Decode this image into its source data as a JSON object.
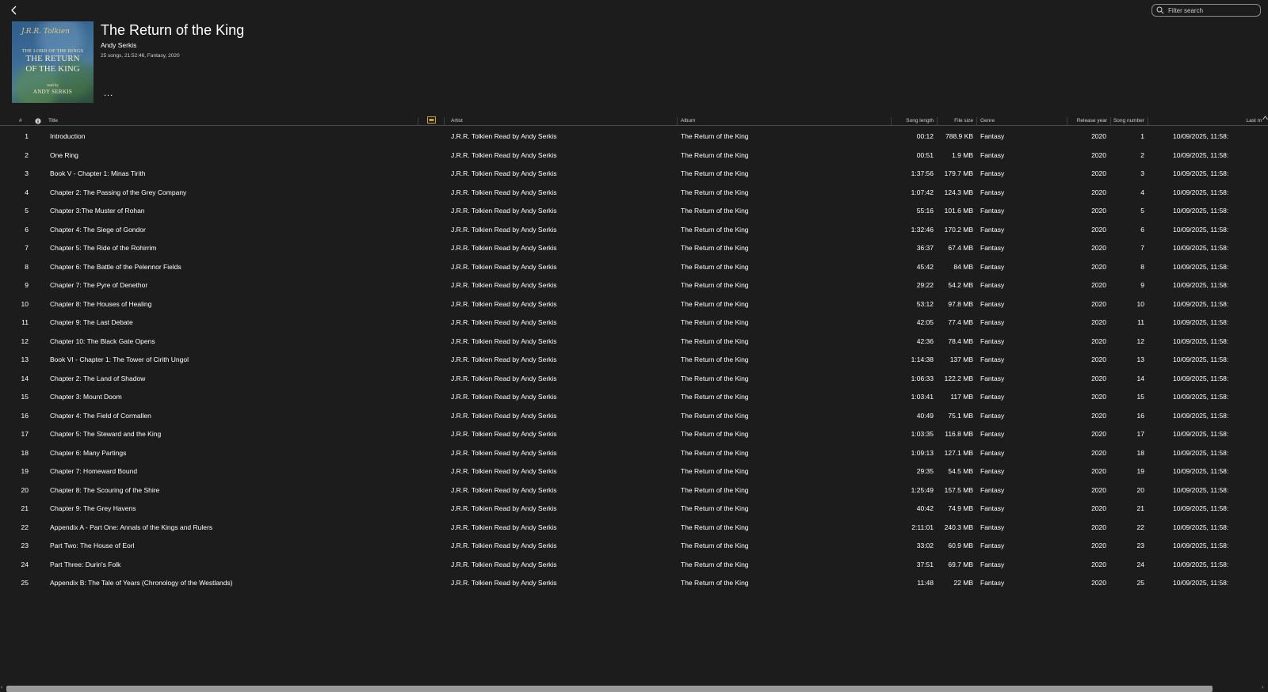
{
  "search": {
    "placeholder": "Filter search"
  },
  "album": {
    "title": "The Return of the King",
    "artist": "Andy Serkis",
    "meta": "25 songs, 21:52:46, Fantasy, 2020",
    "more": "...",
    "cover": {
      "signature": "J.R.R. Tolkien",
      "line1": "THE LORD OF THE RINGS",
      "line2": "THE RETURN",
      "line3": "OF THE KING",
      "line4": "read by",
      "line5": "ANDY SERKIS"
    }
  },
  "columns": {
    "num": "#",
    "title": "Title",
    "artist": "Artist",
    "album": "Album",
    "length": "Song length",
    "size": "File size",
    "genre": "Genre",
    "year": "Release year",
    "songnum": "Song number",
    "last": "Last m"
  },
  "rows": [
    {
      "num": "1",
      "title": "Introduction",
      "artist": "J.R.R. Tolkien Read by Andy Serkis",
      "album": "The Return of the King",
      "length": "00:12",
      "size": "788.9 KB",
      "genre": "Fantasy",
      "year": "2020",
      "songnum": "1",
      "last": "10/09/2025, 11:58:"
    },
    {
      "num": "2",
      "title": "One Ring",
      "artist": "J.R.R. Tolkien Read by Andy Serkis",
      "album": "The Return of the King",
      "length": "00:51",
      "size": "1.9 MB",
      "genre": "Fantasy",
      "year": "2020",
      "songnum": "2",
      "last": "10/09/2025, 11:58:"
    },
    {
      "num": "3",
      "title": "Book V - Chapter 1: Minas Tirith",
      "artist": "J.R.R. Tolkien Read by Andy Serkis",
      "album": "The Return of the King",
      "length": "1:37:56",
      "size": "179.7 MB",
      "genre": "Fantasy",
      "year": "2020",
      "songnum": "3",
      "last": "10/09/2025, 11:58:"
    },
    {
      "num": "4",
      "title": "Chapter 2: The Passing of the Grey Company",
      "artist": "J.R.R. Tolkien Read by Andy Serkis",
      "album": "The Return of the King",
      "length": "1:07:42",
      "size": "124.3 MB",
      "genre": "Fantasy",
      "year": "2020",
      "songnum": "4",
      "last": "10/09/2025, 11:58:"
    },
    {
      "num": "5",
      "title": "Chapter 3:The Muster of Rohan",
      "artist": "J.R.R. Tolkien Read by Andy Serkis",
      "album": "The Return of the King",
      "length": "55:16",
      "size": "101.6 MB",
      "genre": "Fantasy",
      "year": "2020",
      "songnum": "5",
      "last": "10/09/2025, 11:58:"
    },
    {
      "num": "6",
      "title": "Chapter 4: The Siege of Gondor",
      "artist": "J.R.R. Tolkien Read by Andy Serkis",
      "album": "The Return of the King",
      "length": "1:32:46",
      "size": "170.2 MB",
      "genre": "Fantasy",
      "year": "2020",
      "songnum": "6",
      "last": "10/09/2025, 11:58:"
    },
    {
      "num": "7",
      "title": "Chapter 5: The Ride of the Rohirrim",
      "artist": "J.R.R. Tolkien Read by Andy Serkis",
      "album": "The Return of the King",
      "length": "36:37",
      "size": "67.4 MB",
      "genre": "Fantasy",
      "year": "2020",
      "songnum": "7",
      "last": "10/09/2025, 11:58:"
    },
    {
      "num": "8",
      "title": "Chapter 6: The Battle of the Pelennor Fields",
      "artist": "J.R.R. Tolkien Read by Andy Serkis",
      "album": "The Return of the King",
      "length": "45:42",
      "size": "84 MB",
      "genre": "Fantasy",
      "year": "2020",
      "songnum": "8",
      "last": "10/09/2025, 11:58:"
    },
    {
      "num": "9",
      "title": "Chapter 7: The Pyre of Denethor",
      "artist": "J.R.R. Tolkien Read by Andy Serkis",
      "album": "The Return of the King",
      "length": "29:22",
      "size": "54.2 MB",
      "genre": "Fantasy",
      "year": "2020",
      "songnum": "9",
      "last": "10/09/2025, 11:58:"
    },
    {
      "num": "10",
      "title": "Chapter 8: The Houses of Healing",
      "artist": "J.R.R. Tolkien Read by Andy Serkis",
      "album": "The Return of the King",
      "length": "53:12",
      "size": "97.8 MB",
      "genre": "Fantasy",
      "year": "2020",
      "songnum": "10",
      "last": "10/09/2025, 11:58:"
    },
    {
      "num": "11",
      "title": "Chapter 9: The Last Debate",
      "artist": "J.R.R. Tolkien Read by Andy Serkis",
      "album": "The Return of the King",
      "length": "42:05",
      "size": "77.4 MB",
      "genre": "Fantasy",
      "year": "2020",
      "songnum": "11",
      "last": "10/09/2025, 11:58:"
    },
    {
      "num": "12",
      "title": "Chapter 10: The Black Gate Opens",
      "artist": "J.R.R. Tolkien Read by Andy Serkis",
      "album": "The Return of the King",
      "length": "42:36",
      "size": "78.4 MB",
      "genre": "Fantasy",
      "year": "2020",
      "songnum": "12",
      "last": "10/09/2025, 11:58:"
    },
    {
      "num": "13",
      "title": "Book VI - Chapter 1: The Tower of Cirith Ungol",
      "artist": "J.R.R. Tolkien Read by Andy Serkis",
      "album": "The Return of the King",
      "length": "1:14:38",
      "size": "137 MB",
      "genre": "Fantasy",
      "year": "2020",
      "songnum": "13",
      "last": "10/09/2025, 11:58:"
    },
    {
      "num": "14",
      "title": "Chapter 2: The Land of Shadow",
      "artist": "J.R.R. Tolkien Read by Andy Serkis",
      "album": "The Return of the King",
      "length": "1:06:33",
      "size": "122.2 MB",
      "genre": "Fantasy",
      "year": "2020",
      "songnum": "14",
      "last": "10/09/2025, 11:58:"
    },
    {
      "num": "15",
      "title": "Chapter 3: Mount Doom",
      "artist": "J.R.R. Tolkien Read by Andy Serkis",
      "album": "The Return of the King",
      "length": "1:03:41",
      "size": "117 MB",
      "genre": "Fantasy",
      "year": "2020",
      "songnum": "15",
      "last": "10/09/2025, 11:58:"
    },
    {
      "num": "16",
      "title": "Chapter 4: The Field of Cormallen",
      "artist": "J.R.R. Tolkien Read by Andy Serkis",
      "album": "The Return of the King",
      "length": "40:49",
      "size": "75.1 MB",
      "genre": "Fantasy",
      "year": "2020",
      "songnum": "16",
      "last": "10/09/2025, 11:58:"
    },
    {
      "num": "17",
      "title": "Chapter 5: The Steward and the King",
      "artist": "J.R.R. Tolkien Read by Andy Serkis",
      "album": "The Return of the King",
      "length": "1:03:35",
      "size": "116.8 MB",
      "genre": "Fantasy",
      "year": "2020",
      "songnum": "17",
      "last": "10/09/2025, 11:58:"
    },
    {
      "num": "18",
      "title": "Chapter 6: Many Partings",
      "artist": "J.R.R. Tolkien Read by Andy Serkis",
      "album": "The Return of the King",
      "length": "1:09:13",
      "size": "127.1 MB",
      "genre": "Fantasy",
      "year": "2020",
      "songnum": "18",
      "last": "10/09/2025, 11:58:"
    },
    {
      "num": "19",
      "title": "Chapter 7: Homeward Bound",
      "artist": "J.R.R. Tolkien Read by Andy Serkis",
      "album": "The Return of the King",
      "length": "29:35",
      "size": "54.5 MB",
      "genre": "Fantasy",
      "year": "2020",
      "songnum": "19",
      "last": "10/09/2025, 11:58:"
    },
    {
      "num": "20",
      "title": "Chapter 8: The Scouring of the Shire",
      "artist": "J.R.R. Tolkien Read by Andy Serkis",
      "album": "The Return of the King",
      "length": "1:25:49",
      "size": "157.5 MB",
      "genre": "Fantasy",
      "year": "2020",
      "songnum": "20",
      "last": "10/09/2025, 11:58:"
    },
    {
      "num": "21",
      "title": "Chapter 9: The Grey Havens",
      "artist": "J.R.R. Tolkien Read by Andy Serkis",
      "album": "The Return of the King",
      "length": "40:42",
      "size": "74.9 MB",
      "genre": "Fantasy",
      "year": "2020",
      "songnum": "21",
      "last": "10/09/2025, 11:58:"
    },
    {
      "num": "22",
      "title": "Appendix A - Part One: Annals of the Kings and Rulers",
      "artist": "J.R.R. Tolkien Read by Andy Serkis",
      "album": "The Return of the King",
      "length": "2:11:01",
      "size": "240.3 MB",
      "genre": "Fantasy",
      "year": "2020",
      "songnum": "22",
      "last": "10/09/2025, 11:58:"
    },
    {
      "num": "23",
      "title": "Part Two: The House of Eorl",
      "artist": "J.R.R. Tolkien Read by Andy Serkis",
      "album": "The Return of the King",
      "length": "33:02",
      "size": "60.9 MB",
      "genre": "Fantasy",
      "year": "2020",
      "songnum": "23",
      "last": "10/09/2025, 11:58:"
    },
    {
      "num": "24",
      "title": "Part Three: Durin's Folk",
      "artist": "J.R.R. Tolkien Read by Andy Serkis",
      "album": "The Return of the King",
      "length": "37:51",
      "size": "69.7 MB",
      "genre": "Fantasy",
      "year": "2020",
      "songnum": "24",
      "last": "10/09/2025, 11:58:"
    },
    {
      "num": "25",
      "title": "Appendix B: The Tale of Years (Chronology of the Westlands)",
      "artist": "J.R.R. Tolkien Read by Andy Serkis",
      "album": "The Return of the King",
      "length": "11:48",
      "size": "22 MB",
      "genre": "Fantasy",
      "year": "2020",
      "songnum": "25",
      "last": "10/09/2025, 11:58:"
    }
  ],
  "colors": {
    "background": "#1c1c1c",
    "text": "#ffffff",
    "muted": "#cfcfcf",
    "scrollbar": "#9a9a9a"
  }
}
